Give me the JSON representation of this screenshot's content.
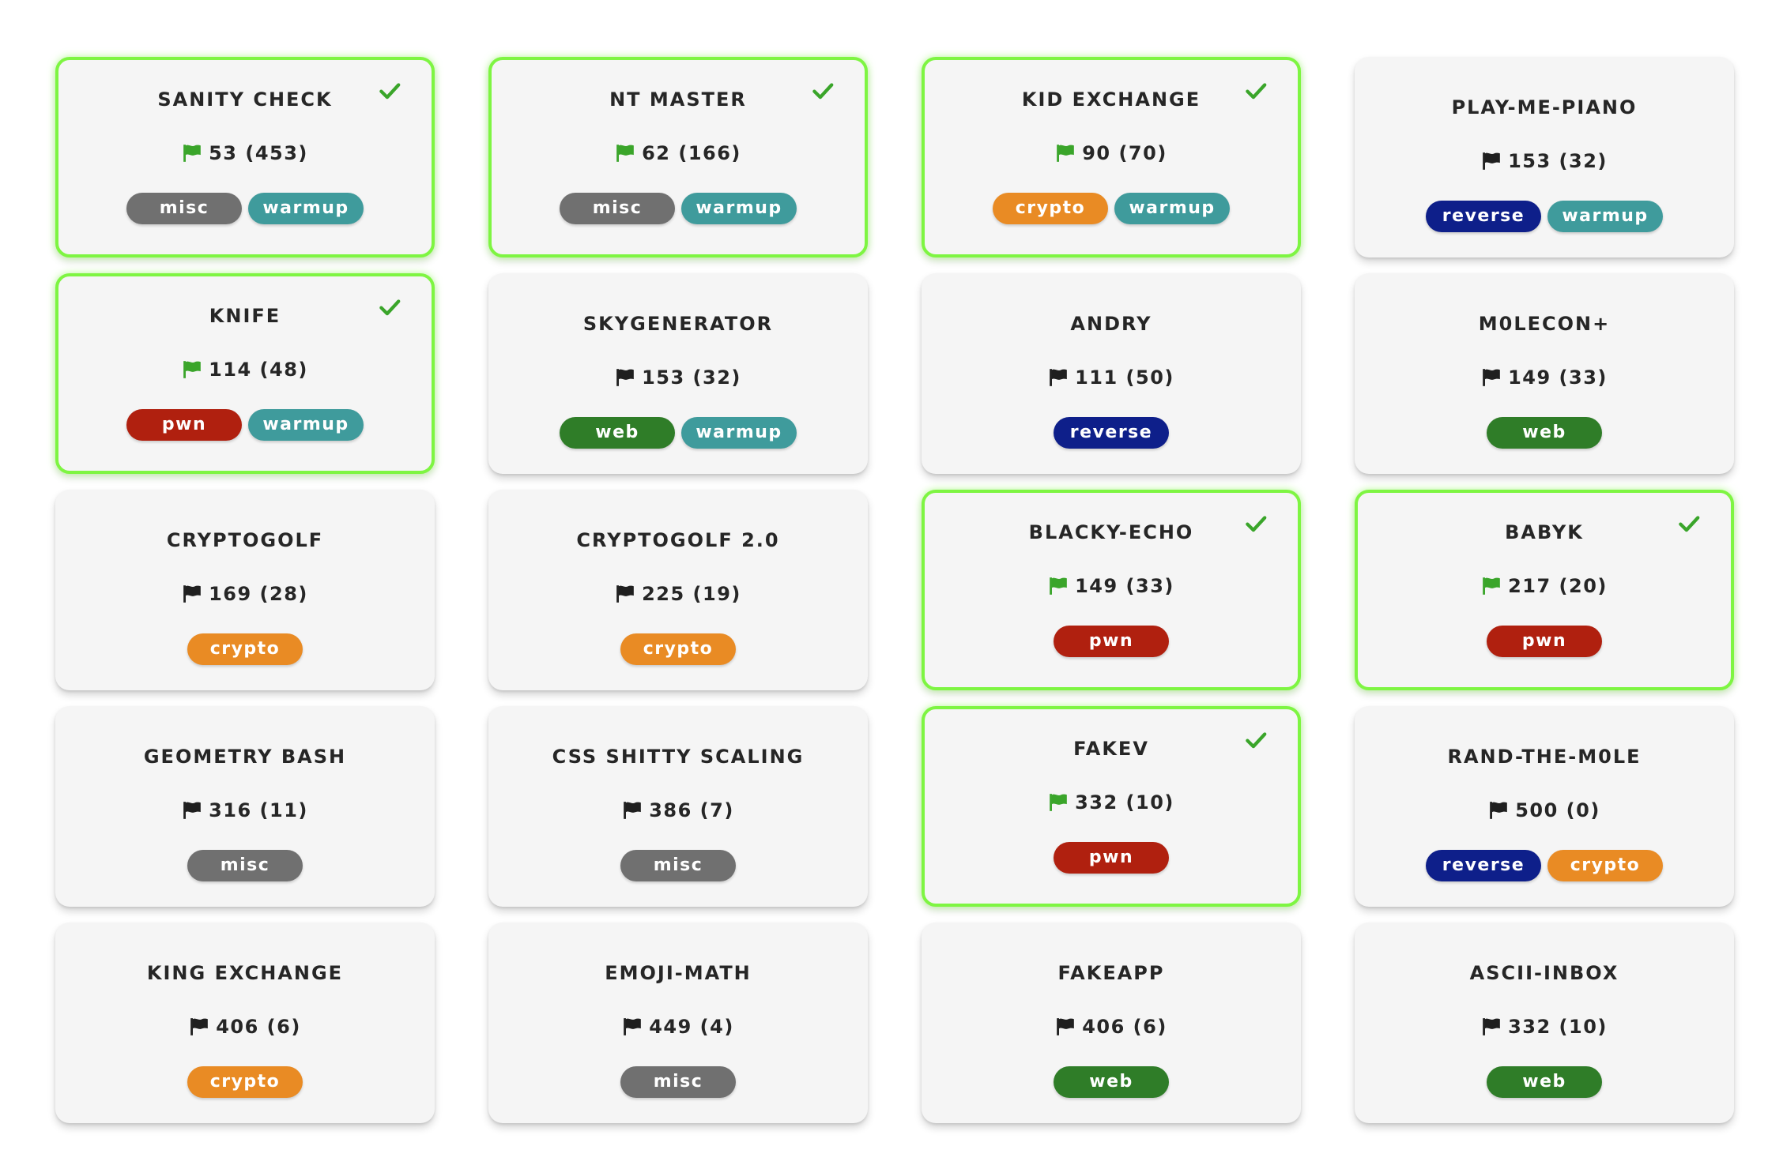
{
  "tag_colors": {
    "misc": "#707070",
    "warmup": "#3f9b9c",
    "crypto": "#e98b24",
    "reverse": "#0e1f8a",
    "web": "#2f7d28",
    "pwn": "#b0200f"
  },
  "flag_colors": {
    "solved": "#3aa52a",
    "unsolved": "#1f1f1f"
  },
  "check_color": "#3aa52a",
  "challenges": [
    {
      "name": "SANITY CHECK",
      "score": "53 (453)",
      "solved": true,
      "tags": [
        "misc",
        "warmup"
      ]
    },
    {
      "name": "NT MASTER",
      "score": "62 (166)",
      "solved": true,
      "tags": [
        "misc",
        "warmup"
      ]
    },
    {
      "name": "KID EXCHANGE",
      "score": "90 (70)",
      "solved": true,
      "tags": [
        "crypto",
        "warmup"
      ]
    },
    {
      "name": "PLAY-ME-PIANO",
      "score": "153 (32)",
      "solved": false,
      "tags": [
        "reverse",
        "warmup"
      ]
    },
    {
      "name": "KNIFE",
      "score": "114 (48)",
      "solved": true,
      "tags": [
        "pwn",
        "warmup"
      ]
    },
    {
      "name": "SKYGENERATOR",
      "score": "153 (32)",
      "solved": false,
      "tags": [
        "web",
        "warmup"
      ]
    },
    {
      "name": "ANDRY",
      "score": "111 (50)",
      "solved": false,
      "tags": [
        "reverse"
      ]
    },
    {
      "name": "M0LECON+",
      "score": "149 (33)",
      "solved": false,
      "tags": [
        "web"
      ]
    },
    {
      "name": "CRYPTOGOLF",
      "score": "169 (28)",
      "solved": false,
      "tags": [
        "crypto"
      ]
    },
    {
      "name": "CRYPTOGOLF 2.0",
      "score": "225 (19)",
      "solved": false,
      "tags": [
        "crypto"
      ]
    },
    {
      "name": "BLACKY-ECHO",
      "score": "149 (33)",
      "solved": true,
      "tags": [
        "pwn"
      ]
    },
    {
      "name": "BABYK",
      "score": "217 (20)",
      "solved": true,
      "tags": [
        "pwn"
      ]
    },
    {
      "name": "GEOMETRY BASH",
      "score": "316 (11)",
      "solved": false,
      "tags": [
        "misc"
      ]
    },
    {
      "name": "CSS SHITTY SCALING",
      "score": "386 (7)",
      "solved": false,
      "tags": [
        "misc"
      ]
    },
    {
      "name": "FAKEV",
      "score": "332 (10)",
      "solved": true,
      "tags": [
        "pwn"
      ]
    },
    {
      "name": "RAND-THE-M0LE",
      "score": "500 (0)",
      "solved": false,
      "tags": [
        "reverse",
        "crypto"
      ]
    },
    {
      "name": "KING EXCHANGE",
      "score": "406 (6)",
      "solved": false,
      "tags": [
        "crypto"
      ]
    },
    {
      "name": "EMOJI-MATH",
      "score": "449 (4)",
      "solved": false,
      "tags": [
        "misc"
      ]
    },
    {
      "name": "FAKEAPP",
      "score": "406 (6)",
      "solved": false,
      "tags": [
        "web"
      ]
    },
    {
      "name": "ASCII-INBOX",
      "score": "332 (10)",
      "solved": false,
      "tags": [
        "web"
      ]
    }
  ]
}
